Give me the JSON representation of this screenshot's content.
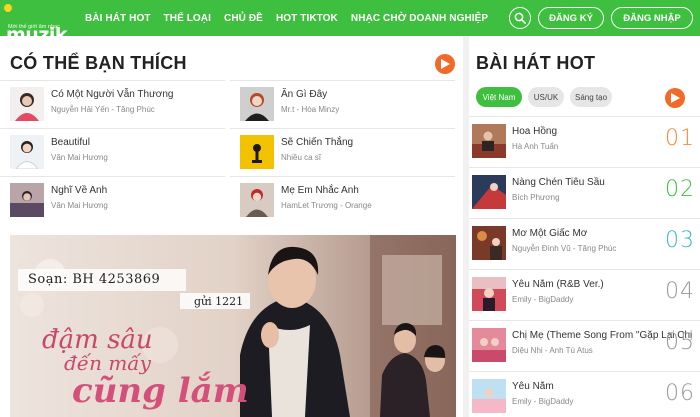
{
  "header": {
    "logo_text": "muzik",
    "logo_tagline": "Mới thế giới âm nhạc",
    "nav": [
      "BÀI HÁT HOT",
      "THỂ LOẠI",
      "CHỦ ĐỀ",
      "HOT TIKTOK",
      "NHẠC CHỜ DOANH NGHIỆP"
    ],
    "register_label": "ĐĂNG KÝ",
    "login_label": "ĐĂNG NHẬP"
  },
  "suggest": {
    "title": "CÓ THỂ BẠN THÍCH",
    "items": [
      {
        "title": "Có Một Người Vẫn Thương",
        "artist": "Nguyễn Hải Yến - Tăng Phúc"
      },
      {
        "title": "Beautiful",
        "artist": "Văn Mai Hương"
      },
      {
        "title": "Nghĩ Về Anh",
        "artist": "Văn Mai Hương"
      },
      {
        "title": "Ăn Gì Đây",
        "artist": "Mr.t - Hòa Minzy"
      },
      {
        "title": "Sẽ Chiến Thắng",
        "artist": "Nhiều ca sĩ"
      },
      {
        "title": "Mẹ Em Nhắc Anh",
        "artist": "HamLet Trương - Orange"
      }
    ]
  },
  "banner": {
    "code": "Soạn: BH 4253869",
    "send_to": "gửi 1221",
    "line1": "đậm sâu",
    "line2": "đến mấy",
    "line3": "cũng lắm"
  },
  "hot": {
    "title": "BÀI HÁT HOT",
    "tabs": [
      "Việt Nam",
      "US/UK",
      "Sáng tạo"
    ],
    "items": [
      {
        "title": "Hoa Hồng",
        "artist": "Hà Anh Tuấn",
        "rank": "01"
      },
      {
        "title": "Nàng Chén Tiêu Sầu",
        "artist": "Bích Phương",
        "rank": "02"
      },
      {
        "title": "Mơ Một Giấc Mơ",
        "artist": "Nguyễn Đình Vũ - Tăng Phúc",
        "rank": "03"
      },
      {
        "title": "Yêu Nắm (R&B Ver.)",
        "artist": "Emily - BigDaddy",
        "rank": "04"
      },
      {
        "title": "Chị Mẹ (Theme Song From \"Gặp Lại Chị B",
        "artist": "Diệu Nhi - Anh Tú Atus",
        "rank": "05"
      },
      {
        "title": "Yêu Nắm",
        "artist": "Emily - BigDaddy",
        "rank": "06"
      }
    ],
    "rank_colors": [
      "#f28a3c",
      "#3fbf3f",
      "#3fb8c9",
      "#999999",
      "#999999",
      "#999999"
    ]
  },
  "colors": {
    "brand_green": "#3fbf3f",
    "accent_orange": "#f26a2a"
  }
}
